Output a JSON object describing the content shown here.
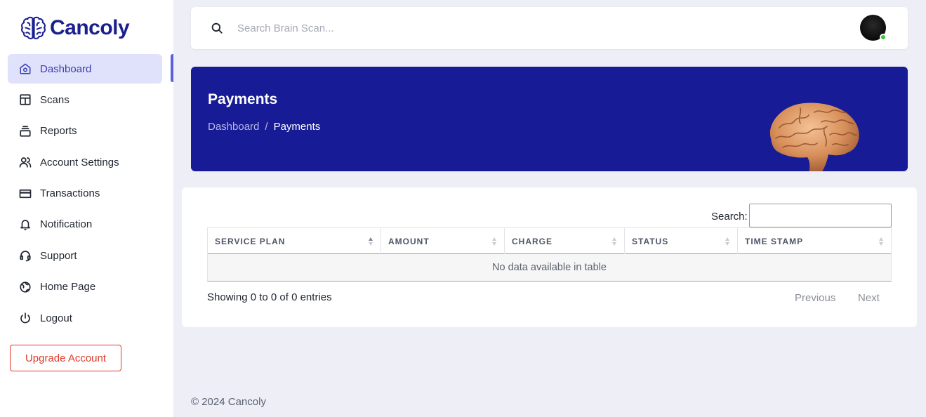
{
  "app": {
    "name": "Cancoly"
  },
  "sidebar": {
    "items": [
      {
        "label": "Dashboard",
        "icon": "home-icon",
        "active": true
      },
      {
        "label": "Scans",
        "icon": "layout-icon"
      },
      {
        "label": "Reports",
        "icon": "stack-icon"
      },
      {
        "label": "Account Settings",
        "icon": "users-icon"
      },
      {
        "label": "Transactions",
        "icon": "credit-card-icon"
      },
      {
        "label": "Notification",
        "icon": "bell-icon"
      },
      {
        "label": "Support",
        "icon": "headset-icon"
      },
      {
        "label": "Home Page",
        "icon": "globe-icon"
      },
      {
        "label": "Logout",
        "icon": "power-icon"
      }
    ],
    "upgrade_label": "Upgrade Account"
  },
  "topbar": {
    "search_placeholder": "Search Brain Scan..."
  },
  "hero": {
    "title": "Payments",
    "breadcrumb": {
      "parent": "Dashboard",
      "separator": "/",
      "current": "Payments"
    }
  },
  "table": {
    "search_label": "Search:",
    "columns": [
      "SERVICE PLAN",
      "AMOUNT",
      "CHARGE",
      "STATUS",
      "TIME STAMP"
    ],
    "empty_message": "No data available in table",
    "info": "Showing 0 to 0 of 0 entries",
    "previous": "Previous",
    "next": "Next"
  },
  "footer": {
    "text": "© 2024 Cancoly"
  },
  "colors": {
    "brand": "#1a1f8f",
    "hero_bg": "#171b96",
    "active_bg": "#e0e1fb",
    "upgrade": "#e0392b",
    "online": "#3cc43c"
  }
}
